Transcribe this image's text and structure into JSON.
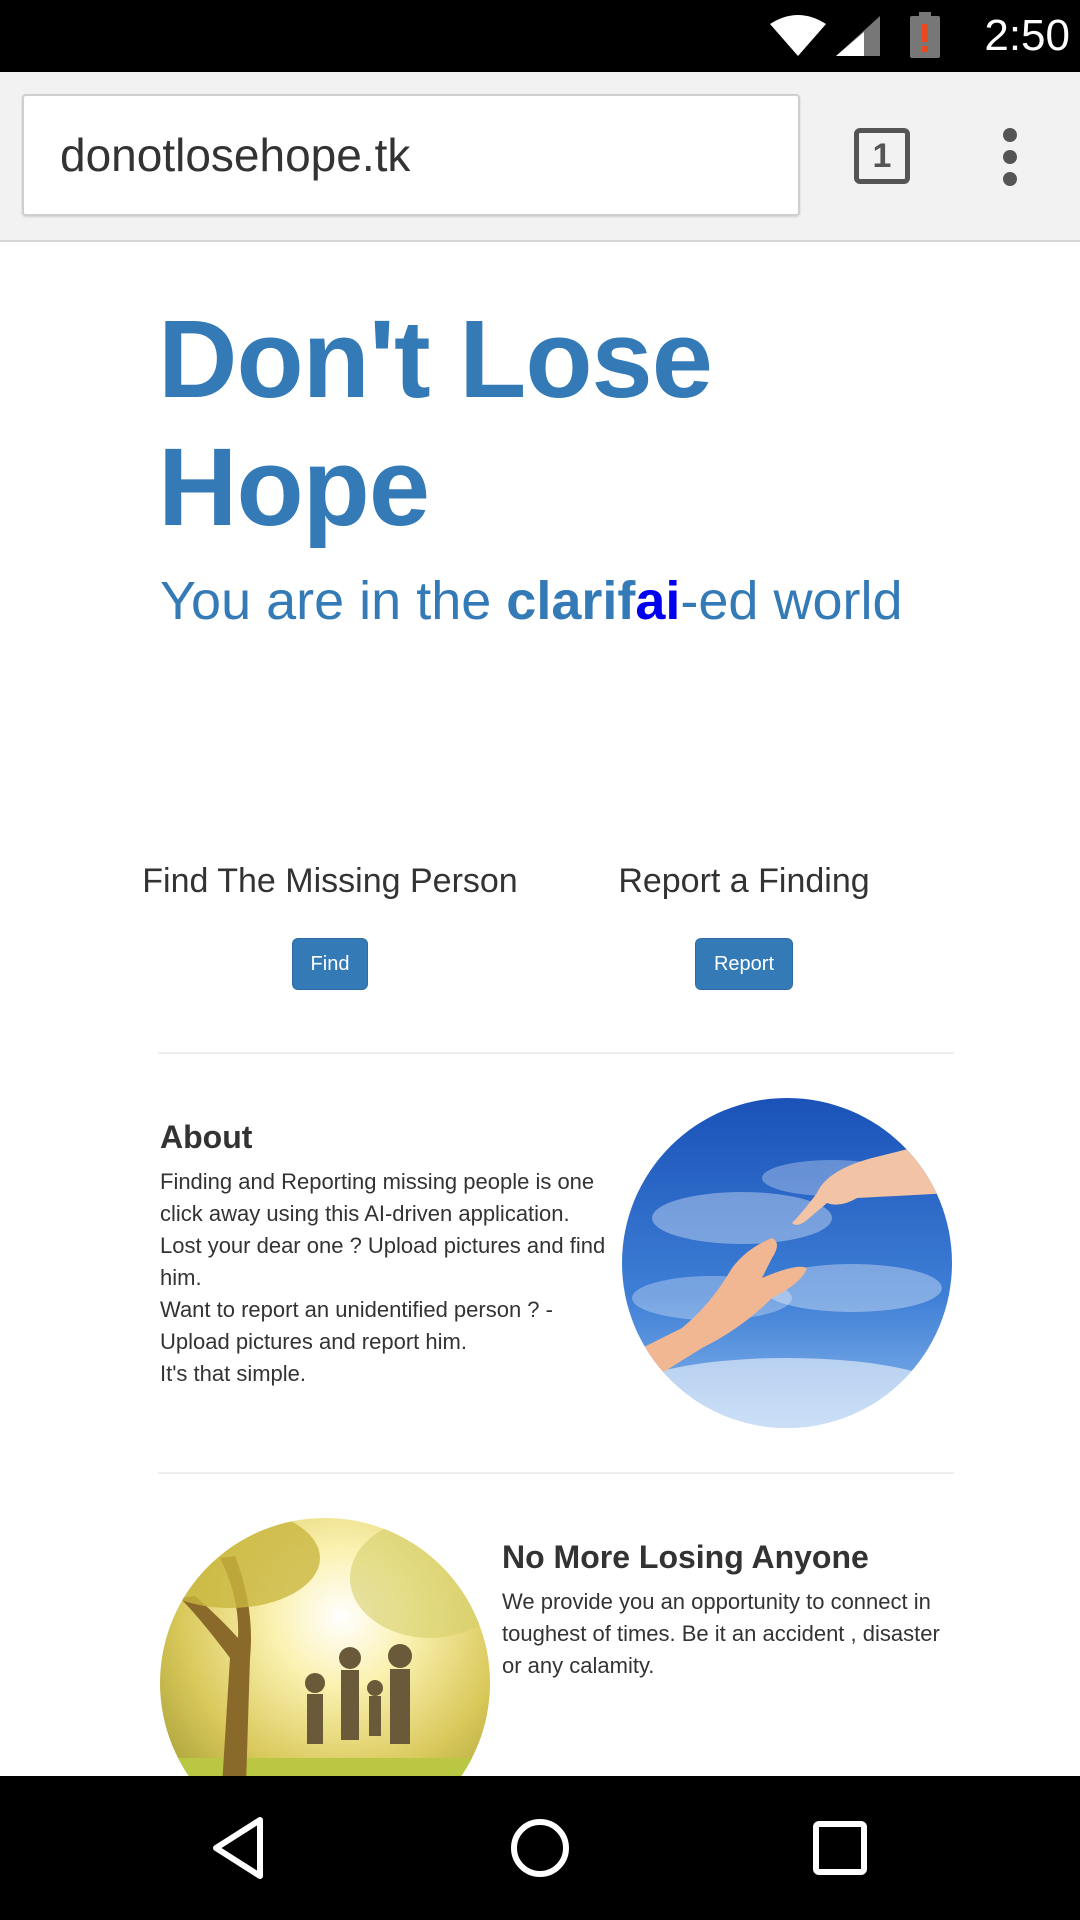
{
  "status_bar": {
    "time": "2:50",
    "icons": [
      "wifi-icon",
      "signal-icon",
      "battery-alert-icon"
    ]
  },
  "browser": {
    "url": "donotlosehope.tk",
    "tab_count": "1",
    "icons": [
      "tabs-icon",
      "more-vert-icon"
    ]
  },
  "hero": {
    "title": "Don't Lose Hope",
    "subtitle_prefix": "You are in the ",
    "subtitle_brand": "clarif",
    "subtitle_brand_ai": "ai",
    "subtitle_suffix": "-ed world"
  },
  "actions": {
    "find": {
      "title": "Find The Missing Person",
      "button": "Find"
    },
    "report": {
      "title": "Report a Finding",
      "button": "Report"
    }
  },
  "about": {
    "title": "About",
    "lines": [
      "Finding and Reporting missing people is one click away using this AI-driven application.",
      "Lost your dear one ? Upload pictures and find him.",
      "Want to report an unidentified person ? - Upload pictures and report him.",
      "It's that simple."
    ],
    "image": "helping-hands-sky-image"
  },
  "no_more": {
    "title": "No More Losing Anyone",
    "text": "We provide you an opportunity to connect in toughest of times. Be it an accident , disaster or any calamity.",
    "image": "family-in-park-image"
  },
  "nav_bar": {
    "icons": [
      "back-icon",
      "home-icon",
      "recents-icon"
    ]
  },
  "colors": {
    "primary": "#337ab7",
    "brand_ai": "#0000ee",
    "text": "#333333"
  }
}
